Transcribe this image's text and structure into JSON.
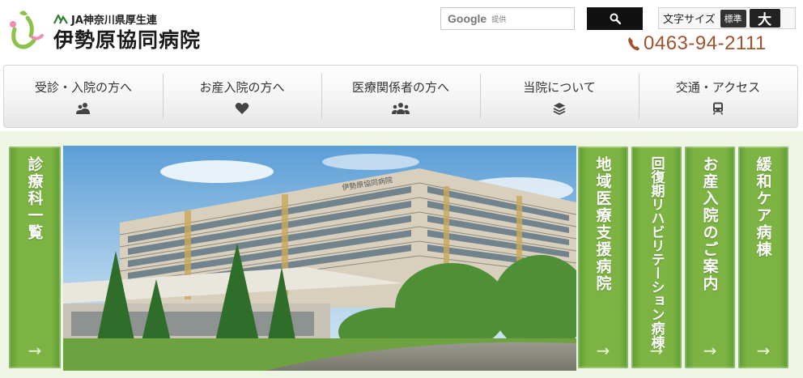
{
  "brand": {
    "org": "JA神奈川県厚生連",
    "name": "伊勢原協同病院"
  },
  "search": {
    "brand": "Google",
    "suffix": "提供",
    "button_icon": "search-icon"
  },
  "font_size": {
    "label": "文字サイズ",
    "standard": "標準",
    "large": "大"
  },
  "contact": {
    "phone": "0463-94-2111",
    "icon": "phone-icon"
  },
  "nav": {
    "items": [
      {
        "label": "受診・入院の方へ",
        "icon": "patients-icon"
      },
      {
        "label": "お産入院の方へ",
        "icon": "heart-icon"
      },
      {
        "label": "医療関係者の方へ",
        "icon": "group-icon"
      },
      {
        "label": "当院について",
        "icon": "layers-icon"
      },
      {
        "label": "交通・アクセス",
        "icon": "train-icon"
      }
    ]
  },
  "side_left": {
    "label": "診療科一覧",
    "arrow": "→"
  },
  "side_right": [
    {
      "label": "地域医療支援病院",
      "arrow": "→"
    },
    {
      "label": "回復期リハビリテーション病棟",
      "arrow": "→"
    },
    {
      "label": "お産入院のご案内",
      "arrow": "→"
    },
    {
      "label": "緩和ケア病棟",
      "arrow": "→"
    }
  ],
  "hero": {
    "sign": "伊勢原協同病院"
  },
  "colors": {
    "accent_green": "#7cb342",
    "phone_brown": "#a0522d",
    "background_tint": "#eef5e2"
  }
}
